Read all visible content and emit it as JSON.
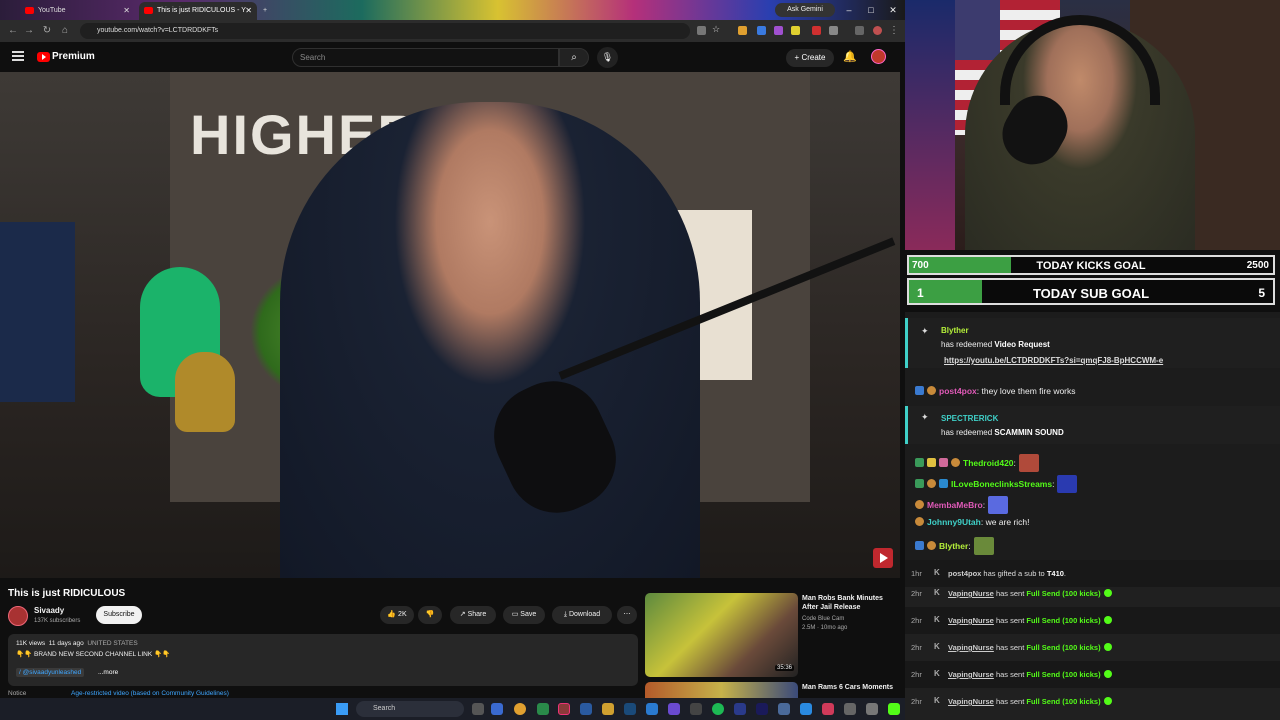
{
  "browser": {
    "tabs": [
      {
        "label": "YouTube",
        "active": false
      },
      {
        "label": "This is just RIDICULOUS - Y",
        "active": true
      }
    ],
    "url": "youtube.com/watch?v=LCTDRDDKFTs",
    "gemini": "Ask Gemini"
  },
  "youtube": {
    "brand": "Premium",
    "search_placeholder": "Search",
    "create_label": "Create",
    "video_title": "This is just RIDICULOUS",
    "channel": {
      "name": "Sivaady",
      "subscribers": "137K subscribers"
    },
    "subscribe_label": "Subscribe",
    "actions": {
      "like_count": "2K",
      "share": "Share",
      "save": "Save",
      "download": "Download"
    },
    "description": {
      "views": "11K views",
      "age": "11 days ago",
      "location": "UNITED STATES",
      "line1": "👇👇 BRAND NEW SECOND CHANNEL LINK 👇👇",
      "handle": "/ @sivaadyunleashed",
      "more": "...more"
    },
    "notice_label": "Notice",
    "notice_link": "Age-restricted video (based on Community Guidelines)",
    "recommendations": [
      {
        "title": "Man Robs Bank Minutes After Jail Release",
        "channel": "Code Blue Cam",
        "stats": "2.5M · 10mo ago",
        "duration": "35:36"
      },
      {
        "title": "Man Rams 6 Cars Moments"
      }
    ],
    "video_overlay_text": "HIGHER LEA"
  },
  "taskbar": {
    "search_placeholder": "Search"
  },
  "stream": {
    "goals": [
      {
        "label": "TODAY KICKS GOAL",
        "current": "700",
        "target": "2500",
        "progress": 0.28
      },
      {
        "label": "TODAY SUB GOAL",
        "current": "1",
        "target": "5",
        "progress": 0.2
      }
    ],
    "redeems": [
      {
        "user": "Blyther",
        "user_color": "#b6f23a",
        "prefix": "has redeemed",
        "reward": "Video Request",
        "link": "https://youtu.be/LCTDRDDKFTs?si=qmqFJ8-BpHCCWM-e"
      },
      {
        "user": "SPECTRERICK",
        "user_color": "#3fd0c8",
        "prefix": "has redeemed",
        "reward": "SCAMMIN SOUND"
      }
    ],
    "messages": [
      {
        "user": "post4pox",
        "color": "#e05ab8",
        "text": ": they love them fire works"
      },
      {
        "user": "Thedroid420",
        "color": "#53fc18",
        "text": ":"
      },
      {
        "user": "ILoveBoneclinksStreams",
        "color": "#53fc18",
        "text": ":"
      },
      {
        "user": "MembaMeBro",
        "color": "#e05ab8",
        "text": ":"
      },
      {
        "user": "Johnny9Utah",
        "color": "#3fd0c8",
        "text": ": we are rich!"
      },
      {
        "user": "Blyther",
        "color": "#b6f23a",
        "text": ":"
      }
    ],
    "kicks": [
      {
        "time": "1hr",
        "user": "post4pox",
        "text": " has gifted a sub to ",
        "target": "T410",
        "end": "."
      },
      {
        "time": "2hr",
        "user": "VapingNurse",
        "text": " has sent ",
        "gift": "Full Send (100 kicks)"
      },
      {
        "time": "2hr",
        "user": "VapingNurse",
        "text": " has sent ",
        "gift": "Full Send (100 kicks)"
      },
      {
        "time": "2hr",
        "user": "VapingNurse",
        "text": " has sent ",
        "gift": "Full Send (100 kicks)"
      },
      {
        "time": "2hr",
        "user": "VapingNurse",
        "text": " has sent ",
        "gift": "Full Send (100 kicks)"
      },
      {
        "time": "2hr",
        "user": "VapingNurse",
        "text": " has sent ",
        "gift": "Full Send (100 kicks)"
      }
    ]
  }
}
